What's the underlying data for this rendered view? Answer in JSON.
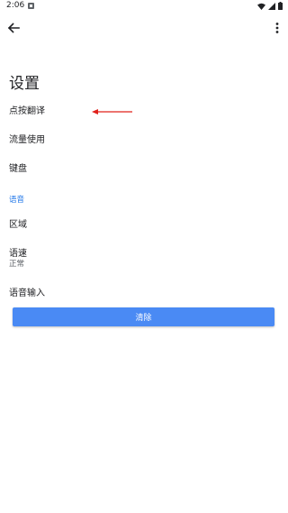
{
  "status_bar": {
    "time": "2:06",
    "icons": [
      "notification-icon",
      "wifi-icon",
      "signal-icon",
      "battery-icon"
    ]
  },
  "toolbar": {
    "back_icon": "arrow-back-icon",
    "more_icon": "more-vert-icon"
  },
  "page": {
    "title": "设置"
  },
  "preferences": {
    "tap_to_translate": "点按翻译",
    "data_usage": "流量使用",
    "keyboard": "键盘",
    "voice_category": "语音",
    "region": "区域",
    "speech_rate": "语速",
    "speech_rate_value": "正常",
    "voice_input": "语音输入"
  },
  "actions": {
    "clear_label": "清除"
  },
  "colors": {
    "accent": "#1a73e8",
    "button": "#4a8af4",
    "annotation": "#e0201a"
  }
}
